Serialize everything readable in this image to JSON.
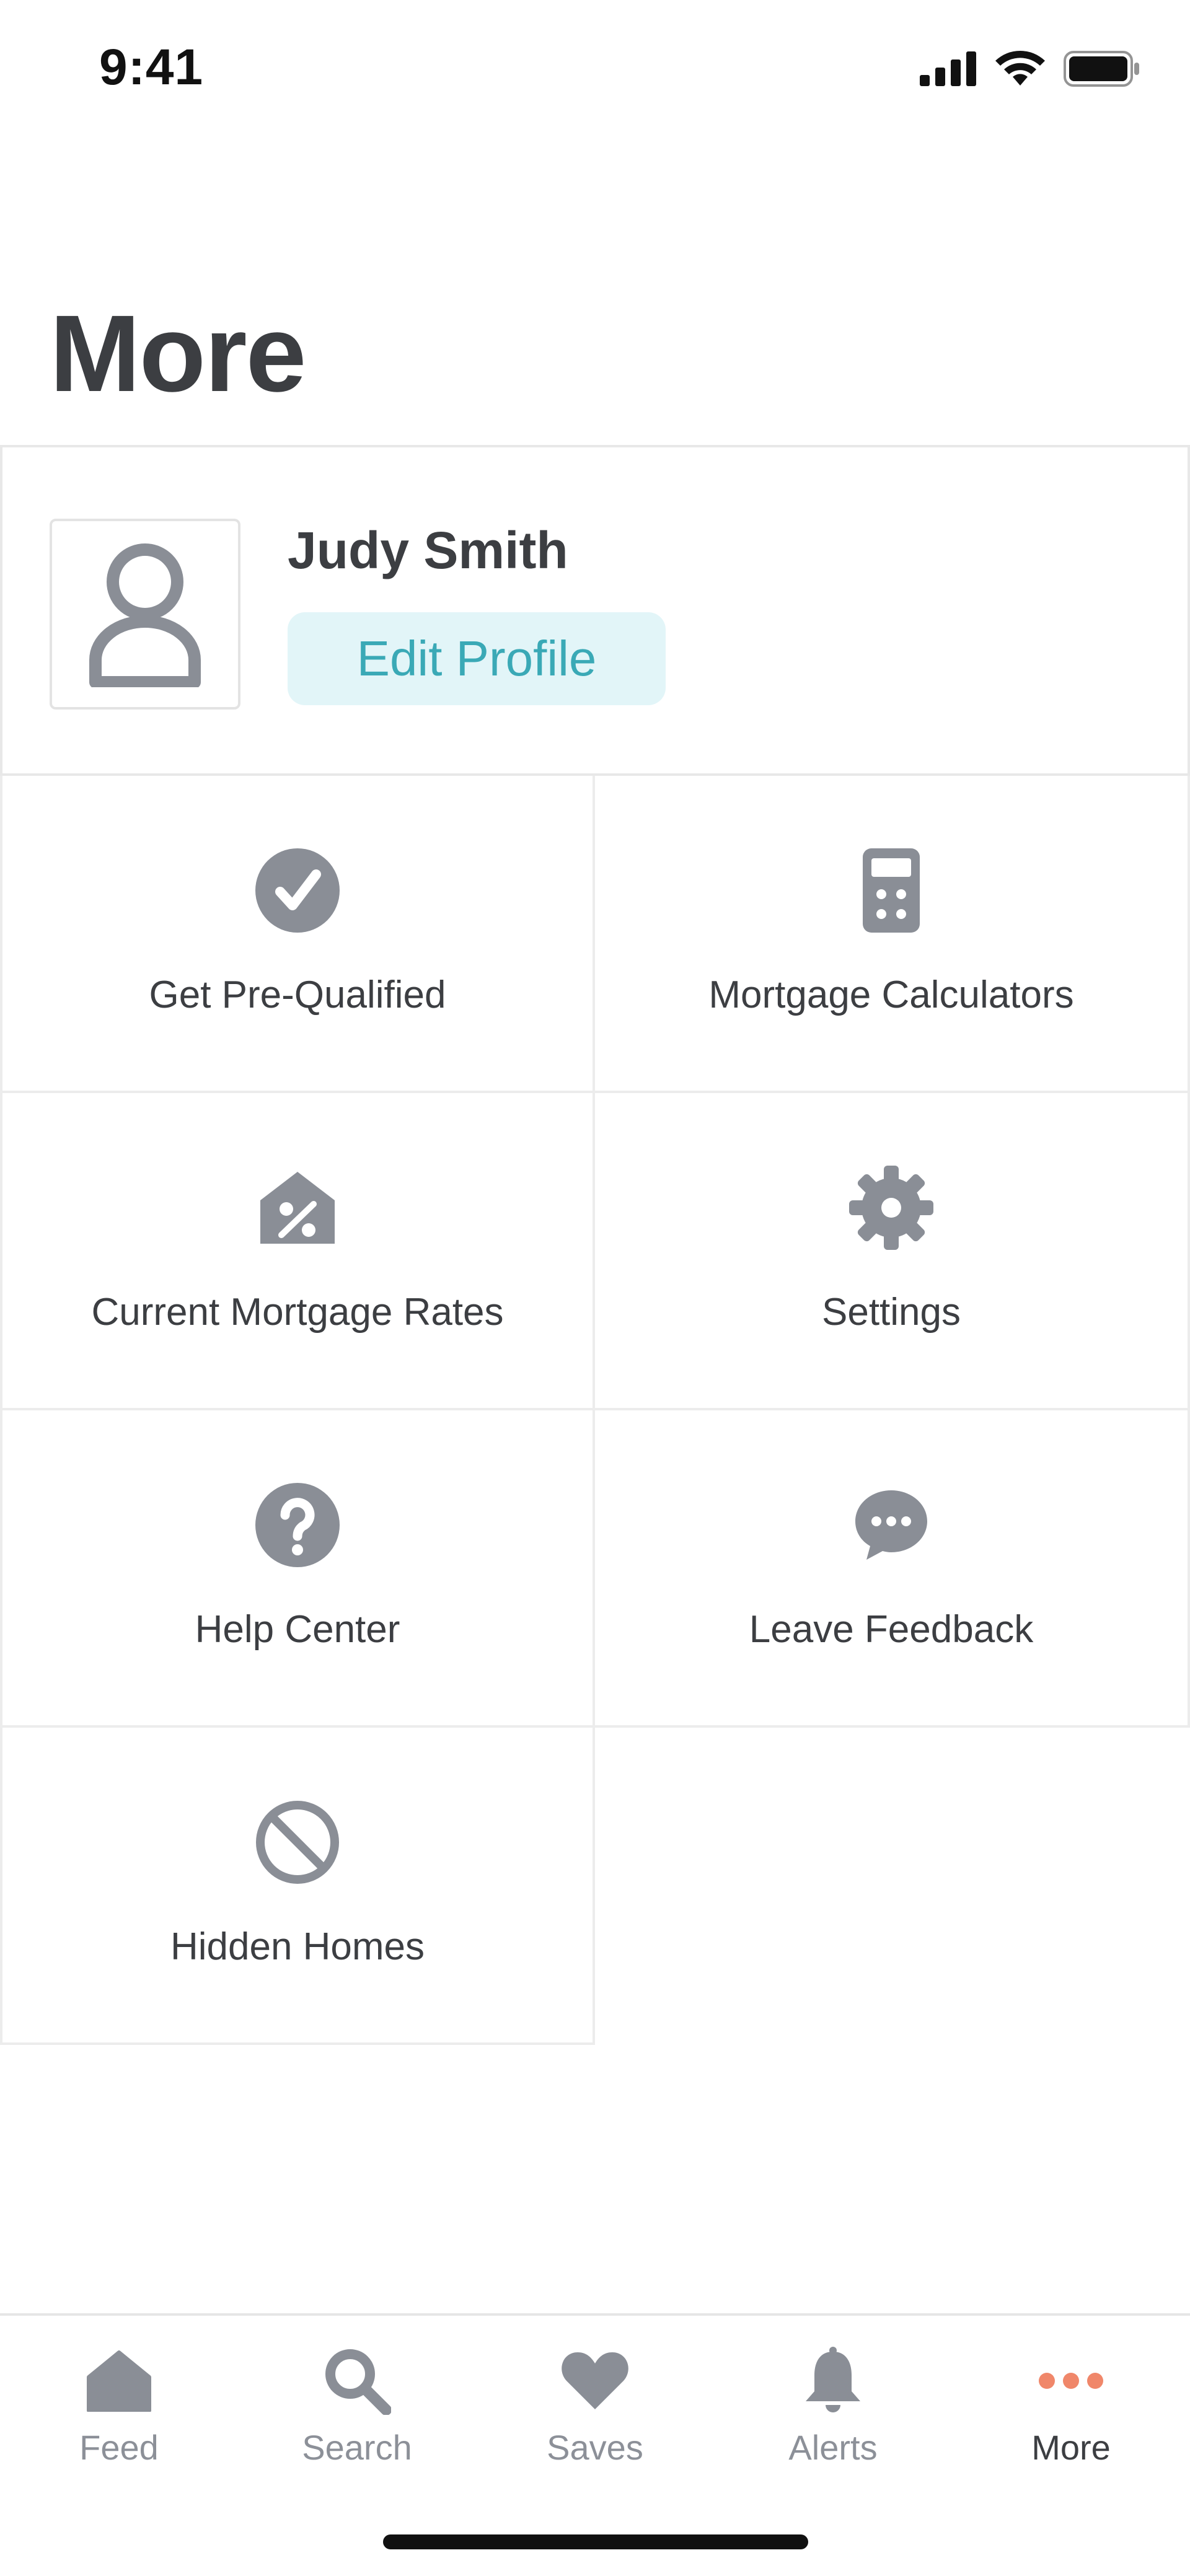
{
  "status_bar": {
    "time": "9:41"
  },
  "page": {
    "title": "More"
  },
  "profile": {
    "name": "Judy Smith",
    "edit_label": "Edit Profile"
  },
  "grid": [
    {
      "label": "Get Pre-Qualified",
      "icon": "check-circle-icon"
    },
    {
      "label": "Mortgage Calculators",
      "icon": "calculator-icon"
    },
    {
      "label": "Current Mortgage Rates",
      "icon": "house-percent-icon"
    },
    {
      "label": "Settings",
      "icon": "gear-icon"
    },
    {
      "label": "Help Center",
      "icon": "question-circle-icon"
    },
    {
      "label": "Leave Feedback",
      "icon": "chat-bubble-icon"
    },
    {
      "label": "Hidden Homes",
      "icon": "prohibited-icon"
    }
  ],
  "tabs": [
    {
      "label": "Feed",
      "icon": "home-icon",
      "active": false
    },
    {
      "label": "Search",
      "icon": "search-icon",
      "active": false
    },
    {
      "label": "Saves",
      "icon": "heart-icon",
      "active": false
    },
    {
      "label": "Alerts",
      "icon": "bell-icon",
      "active": false
    },
    {
      "label": "More",
      "icon": "more-dots-icon",
      "active": true
    }
  ],
  "colors": {
    "icon_gray": "#8a8e96",
    "text_dark": "#3c3e42",
    "accent_teal": "#3aa9b6",
    "accent_teal_bg": "#e2f5f8",
    "active_dots": "#f0876a"
  }
}
